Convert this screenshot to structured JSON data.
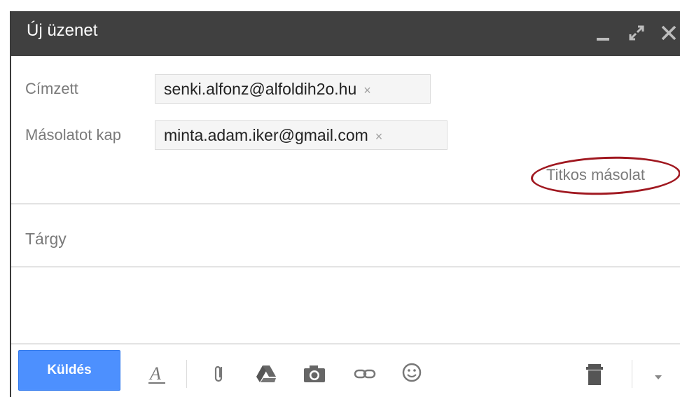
{
  "window": {
    "title": "Új üzenet"
  },
  "recipients": {
    "to_label": "Címzett",
    "to_chip": "senki.alfonz@alfoldih2o.hu",
    "cc_label": "Másolatot kap",
    "cc_chip": "minta.adam.iker@gmail.com",
    "chip_remove": "×",
    "bcc_link": "Titkos másolat"
  },
  "subject": {
    "placeholder": "Tárgy"
  },
  "toolbar": {
    "send_label": "Küldés",
    "icons": [
      "formatting-icon",
      "attach-icon",
      "drive-icon",
      "photo-icon",
      "link-icon",
      "emoji-icon",
      "trash-icon",
      "more-options-icon"
    ]
  },
  "colors": {
    "titlebar": "#404040",
    "send_button": "#4d90fe",
    "annotation_circle": "#a01820"
  }
}
